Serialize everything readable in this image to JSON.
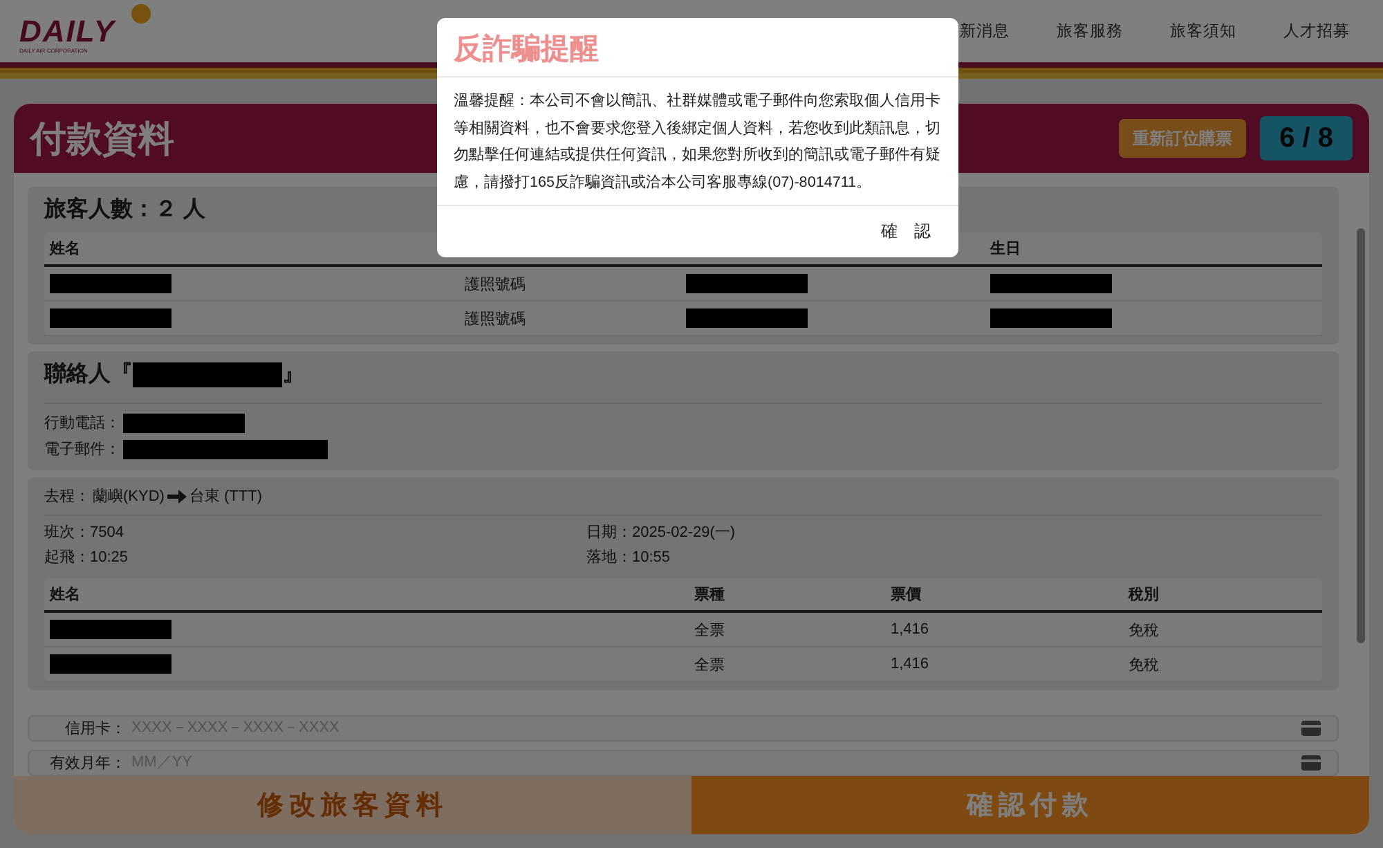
{
  "header": {
    "logo": {
      "brand": "DAILY",
      "tagline": "DAILY AIR CORPORATION"
    },
    "nav": [
      "新消息",
      "旅客服務",
      "旅客須知",
      "人才招募"
    ]
  },
  "page": {
    "title": "付款資料",
    "rebook_button": "重新訂位購票",
    "step": "6 / 8"
  },
  "passengers": {
    "title": "旅客人數：２ 人",
    "name_header": "姓名",
    "birthday_header": "生日",
    "rows": [
      {
        "document_type": "護照號碼"
      },
      {
        "document_type": "護照號碼"
      }
    ]
  },
  "contact": {
    "title_open": "聯絡人『",
    "title_close": "』",
    "fields": [
      {
        "label": "行動電話："
      },
      {
        "label": "電子郵件："
      }
    ]
  },
  "flight": {
    "route_label": "去程：",
    "from": "蘭嶼(KYD)",
    "to": "台東 (TTT)",
    "details": [
      "班次：7504",
      "日期：2025-02-29(一)",
      "起飛：10:25",
      "落地：10:55"
    ],
    "columns": [
      "姓名",
      "票種",
      "票價",
      "稅別"
    ],
    "rows": [
      {
        "cells": [
          "",
          "全票",
          "1,416",
          "免稅"
        ]
      },
      {
        "cells": [
          "",
          "全票",
          "1,416",
          "免稅"
        ]
      }
    ]
  },
  "payment_fields": [
    {
      "label": "信用卡：",
      "placeholder": "XXXX－XXXX－XXXX－XXXX"
    },
    {
      "label": "有效月年：",
      "placeholder": "MM／YY"
    }
  ],
  "actions": [
    {
      "kind": "secondary",
      "label": "修改旅客資料"
    },
    {
      "kind": "primary",
      "label": "確認付款"
    }
  ],
  "modal": {
    "title": "反詐騙提醒",
    "body": "溫馨提醒：本公司不會以簡訊、社群媒體或電子郵件向您索取個人信用卡等相關資料，也不會要求您登入後綁定個人資料，若您收到此類訊息，切勿點擊任何連結或提供任何資訊，如果您對所收到的簡訊或電子郵件有疑慮，請撥打165反詐騙資訊或洽本公司客服專線(07)-8014711。",
    "confirm": "確　認"
  }
}
